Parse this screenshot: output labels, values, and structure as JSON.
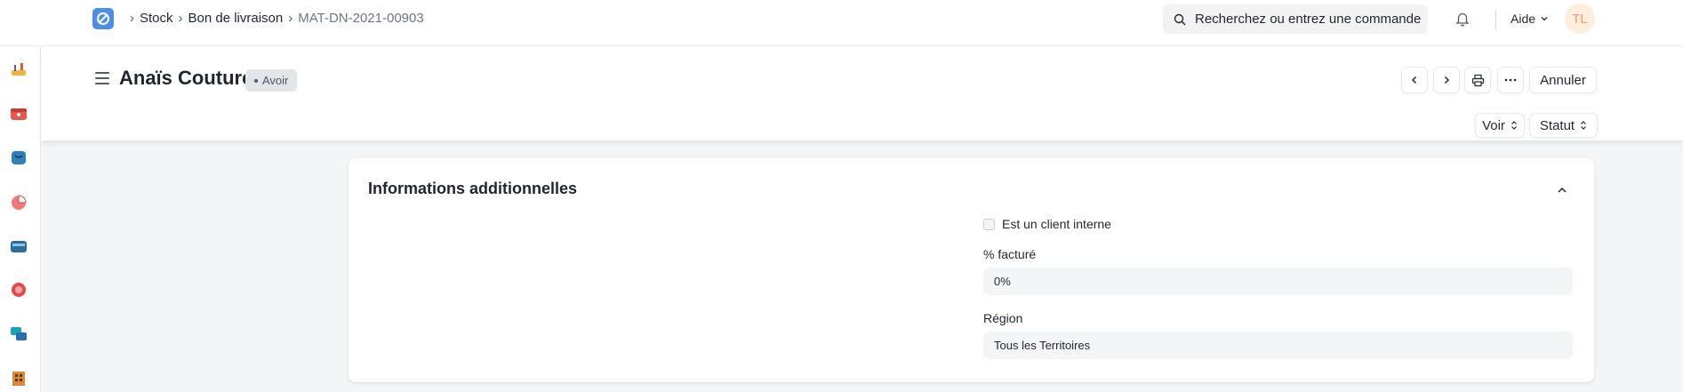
{
  "navbar": {
    "breadcrumbs": [
      "Stock",
      "Bon de livraison",
      "MAT-DN-2021-00903"
    ],
    "search_placeholder": "Recherchez ou entrez une commande",
    "help_label": "Aide",
    "avatar_initials": "TL"
  },
  "sidebar": {
    "icons": [
      "tools-icon",
      "shop-icon",
      "bag-icon",
      "pie-chart-icon",
      "wallet-icon",
      "headset-icon",
      "chat-icon",
      "building-icon"
    ]
  },
  "header": {
    "title": "Anaïs Couture",
    "status": "Avoir",
    "cancel_label": "Annuler",
    "view_label": "Voir",
    "status_label": "Statut"
  },
  "section": {
    "title": "Informations additionnelles",
    "internal_customer_label": "Est un client interne",
    "billed_label": "% facturé",
    "billed_value": "0%",
    "region_label": "Région",
    "region_value": "Tous les Territoires"
  },
  "colors": {
    "accent": "#4d8de6",
    "badge_bg": "#e2e6ea",
    "page_bg": "#f4f5f6"
  }
}
